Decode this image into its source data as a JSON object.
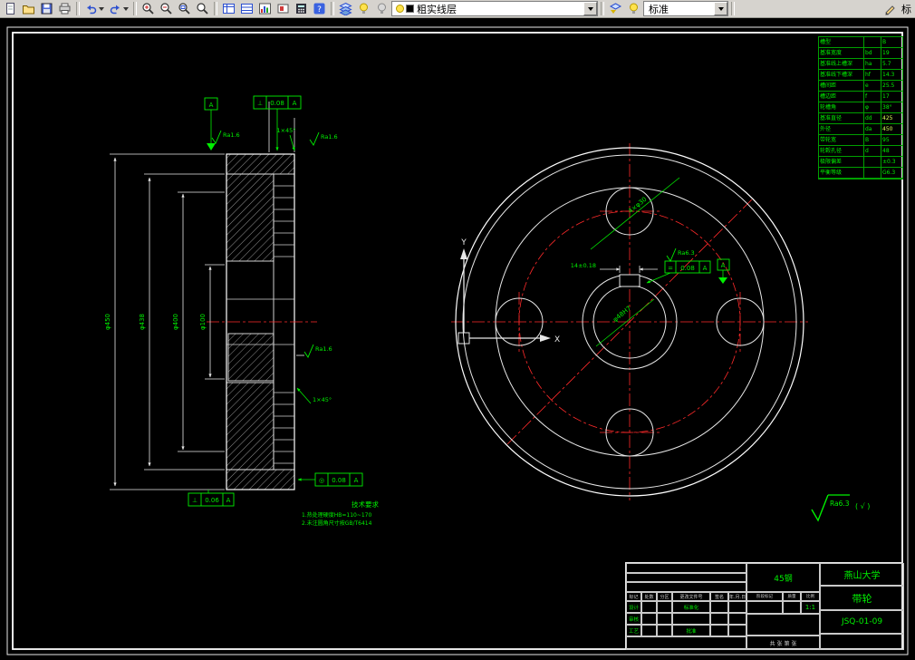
{
  "toolbar": {
    "layer_combo": "粗实线层",
    "style_combo": "标准",
    "help_glyph": "?",
    "trailing": "标"
  },
  "left_view": {
    "dims": [
      {
        "label": "φ450"
      },
      {
        "label": "φ438"
      },
      {
        "label": "φ400"
      },
      {
        "label": "φ100"
      }
    ],
    "ra_top_left": "Ra1.6",
    "chamfer_top": "1×45°",
    "ra_top_right": "Ra1.6",
    "ra_mid": "Ra1.6",
    "chamfer_bottom": "1×45°",
    "tol_top": {
      "sym": "⊥",
      "val": "0.08",
      "datum": "A"
    },
    "tol_bottom_right": {
      "sym": "◎",
      "val": "0.08",
      "datum": "A"
    },
    "tol_bottom_left": {
      "sym": "⊥",
      "val": "0.06",
      "datum": "A"
    },
    "datum_flag": "A"
  },
  "right_view": {
    "hole_callout": "4×φ30",
    "keyway_dim": "14±0.18",
    "bore_label": "φ48H7",
    "ra": "Ra6.3",
    "tol": {
      "sym": "=",
      "val": "0.08",
      "datum": "A"
    },
    "datum_flag": "A",
    "ucs_x": "X",
    "ucs_y": "Y"
  },
  "notes": {
    "tech_title": "技术要求",
    "tech_line1": "1.热处理硬度HB=110~170",
    "tech_line2": "2.未注圆角尺寸按GB/T6414",
    "surface_default": "Ra6.3",
    "surface_suffix": "( √ )"
  },
  "param_table": {
    "rows": [
      {
        "label": "槽型",
        "sym": "",
        "val": "B"
      },
      {
        "label": "基准宽度",
        "sym": "bd",
        "val": "19"
      },
      {
        "label": "基准线上槽深",
        "sym": "ha",
        "val": "5.7"
      },
      {
        "label": "基准线下槽深",
        "sym": "hf",
        "val": "14.3"
      },
      {
        "label": "槽间距",
        "sym": "e",
        "val": "25.5"
      },
      {
        "label": "槽边距",
        "sym": "f",
        "val": "17"
      },
      {
        "label": "轮槽角",
        "sym": "φ",
        "val": "38°"
      },
      {
        "label": "基准直径",
        "sym": "dd",
        "val": "425"
      },
      {
        "label": "外径",
        "sym": "da",
        "val": "450"
      },
      {
        "label": "带轮宽",
        "sym": "B",
        "val": "95"
      },
      {
        "label": "轮毂孔径",
        "sym": "d",
        "val": "48"
      },
      {
        "label": "极限偏差",
        "sym": "",
        "val": "±0.3"
      },
      {
        "label": "平衡等级",
        "sym": "",
        "val": "G6.3"
      }
    ]
  },
  "title_block": {
    "material": "45钢",
    "org": "燕山大学",
    "part": "带轮",
    "code": "JSQ-01-09",
    "scale_value": "1:1",
    "hdr": [
      "标记",
      "处数",
      "分区",
      "更改文件号",
      "签名",
      "年.月.日"
    ],
    "role_design": "设计",
    "role_check": "审核",
    "role_craft": "工艺",
    "role_std": "标准化",
    "role_approve": "批准",
    "col_stage": "阶段标记",
    "col_weight": "质量",
    "col_scale": "比例",
    "sheet_info": "共 张 第 张"
  }
}
